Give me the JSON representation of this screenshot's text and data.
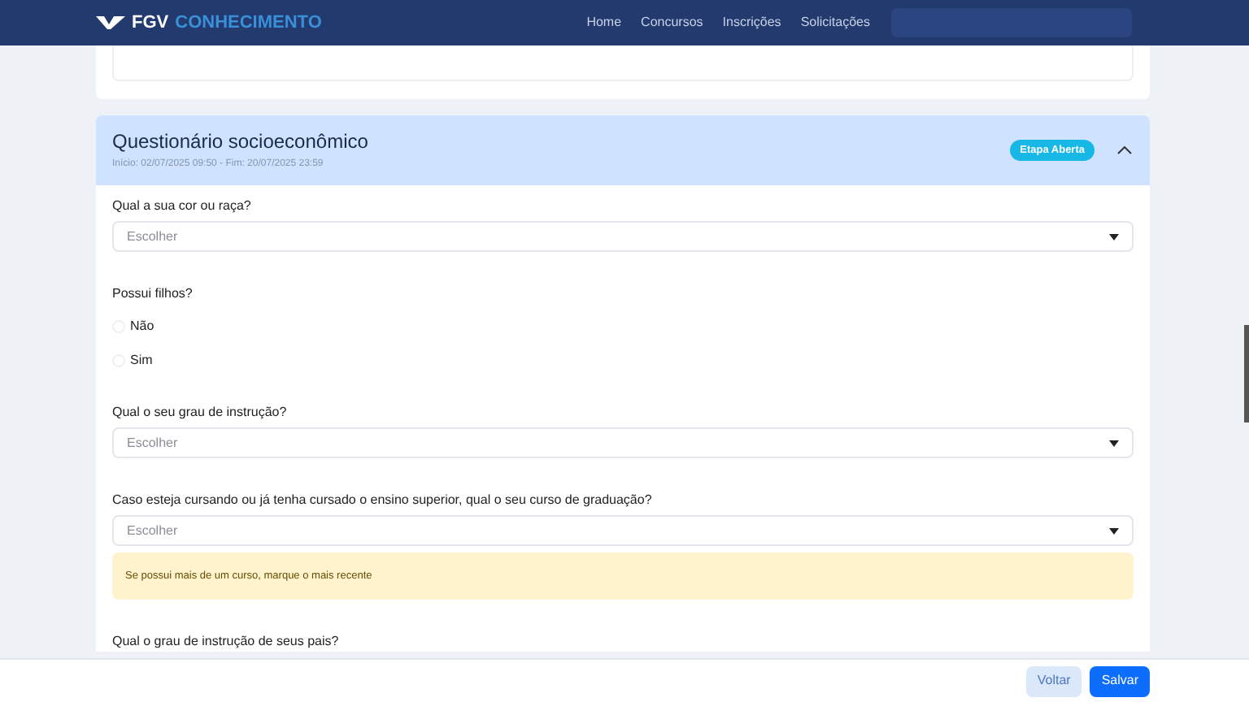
{
  "header": {
    "logo_mark": "FGV",
    "logo_text": "CONHECIMENTO",
    "nav": [
      {
        "label": "Home"
      },
      {
        "label": "Concursos"
      },
      {
        "label": "Inscrições"
      },
      {
        "label": "Solicitações"
      }
    ]
  },
  "section": {
    "title": "Questionário socioeconômico",
    "dates": "Início: 02/07/2025 09:50 - Fim: 20/07/2025 23:59",
    "badge": "Etapa Aberta",
    "expanded": true
  },
  "questions": [
    {
      "kind": "select",
      "label": "Qual a sua cor ou raça?",
      "placeholder": "Escolher"
    },
    {
      "kind": "radio",
      "label": "Possui filhos?",
      "options": [
        {
          "label": "Não",
          "selected": false
        },
        {
          "label": "Sim",
          "selected": false
        }
      ]
    },
    {
      "kind": "select",
      "label": "Qual o seu grau de instrução?",
      "placeholder": "Escolher"
    },
    {
      "kind": "select",
      "label": "Caso esteja cursando ou já tenha cursado o ensino superior, qual o seu curso de graduação?",
      "placeholder": "Escolher",
      "note": "Se possui mais de um curso, marque o mais recente"
    },
    {
      "kind": "label",
      "label": "Qual o grau de instrução de seus pais?"
    }
  ],
  "footer": {
    "buttons": [
      {
        "label": "Voltar",
        "kind": "secondary"
      },
      {
        "label": "Salvar",
        "kind": "primary"
      }
    ]
  }
}
